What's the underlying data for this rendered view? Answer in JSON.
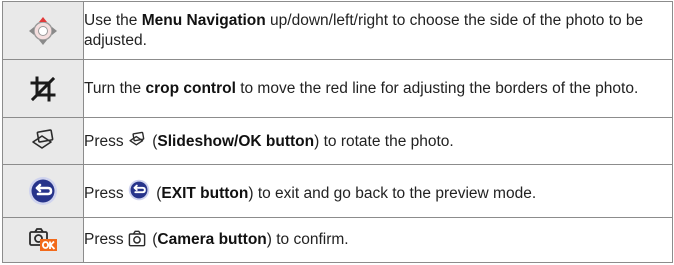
{
  "rows": [
    {
      "icon": "dpad-navigation-icon",
      "prefix": "Use the ",
      "bold": "Menu Navigation",
      "suffix": " up/down/left/right to choose the side of the photo to be adjusted."
    },
    {
      "icon": "crop-icon",
      "prefix": "Turn the ",
      "bold": "crop control",
      "suffix": " to move the red line for adjusting the borders of the photo."
    },
    {
      "icon": "slideshow-ok-icon",
      "prefix": "Press ",
      "inline_icon": "slideshow-ok-icon",
      "open_paren": " (",
      "bold": "Slideshow/OK button",
      "suffix": ") to rotate the photo."
    },
    {
      "icon": "exit-icon",
      "prefix": "Press ",
      "inline_icon": "exit-icon",
      "open_paren": " (",
      "bold": "EXIT button",
      "suffix": ") to exit and go back to the preview mode."
    },
    {
      "icon": "camera-ok-icon",
      "prefix": "Press ",
      "inline_icon": "camera-icon",
      "open_paren": " (",
      "bold": "Camera button",
      "suffix": ") to confirm."
    }
  ],
  "colors": {
    "icon_cell_bg": "#e9e9e9",
    "border": "#8c8c8c",
    "exit_blue": "#27348b",
    "exit_ring": "#cfd3ee",
    "ok_orange": "#f26a1b"
  }
}
